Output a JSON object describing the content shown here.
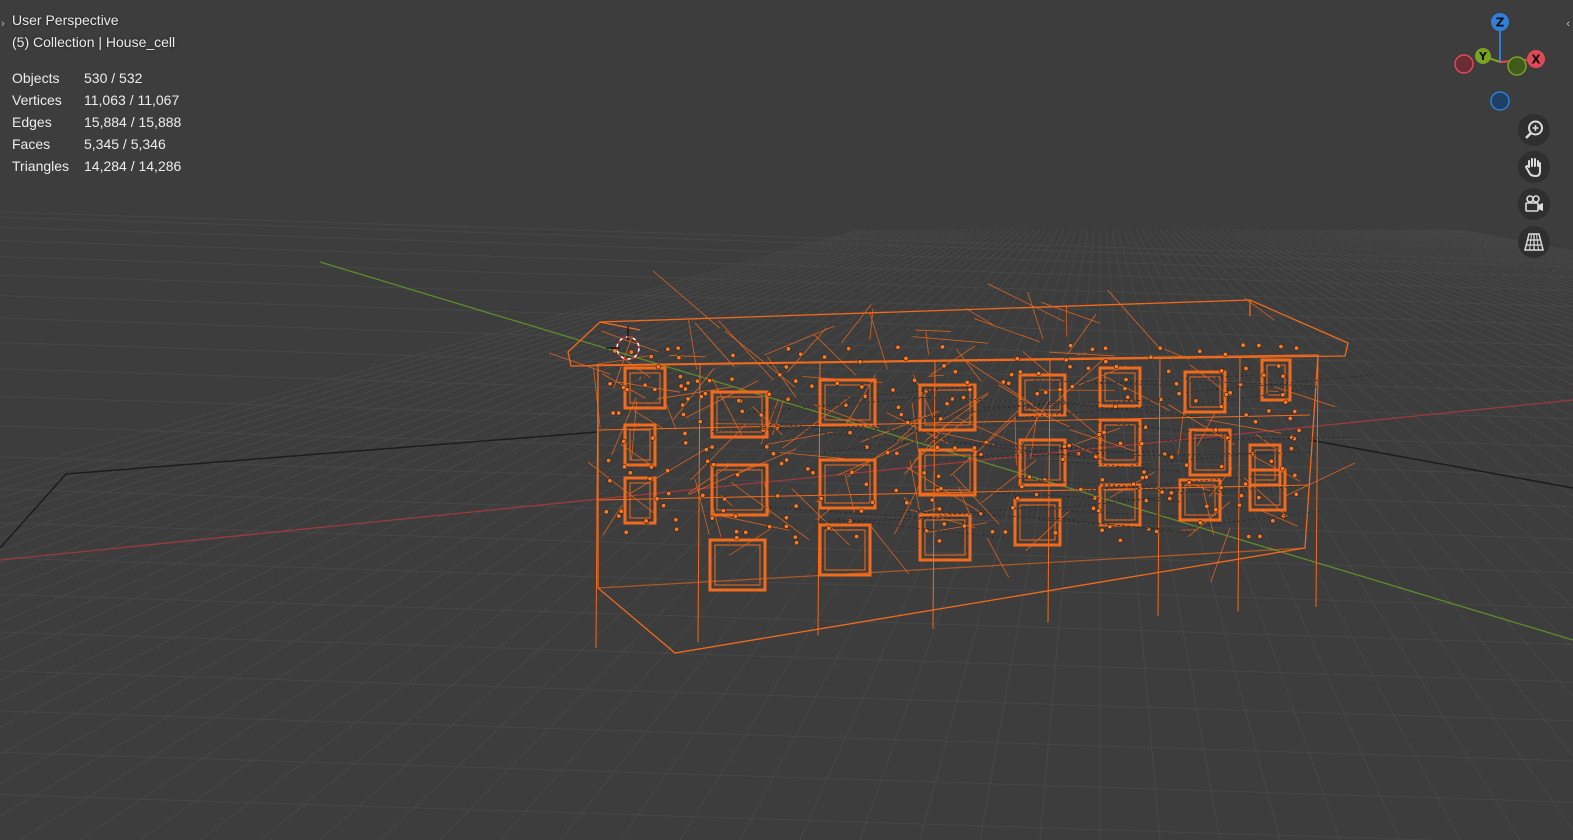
{
  "viewport": {
    "view_name": "User Perspective",
    "collection_line": "(5) Collection | House_cell",
    "stats": [
      {
        "label": "Objects",
        "value": "530 / 532"
      },
      {
        "label": "Vertices",
        "value": "11,063 / 11,067"
      },
      {
        "label": "Edges",
        "value": "15,884 / 15,888"
      },
      {
        "label": "Faces",
        "value": "5,345 / 5,346"
      },
      {
        "label": "Triangles",
        "value": "14,284 / 14,286"
      }
    ]
  },
  "gizmo": {
    "x_label": "X",
    "y_label": "Y",
    "z_label": "Z",
    "colors": {
      "x": "#e04a58",
      "y": "#7aa323",
      "z": "#2f7fd9"
    }
  },
  "nav_buttons": [
    {
      "name": "zoom",
      "icon": "zoom-in-icon"
    },
    {
      "name": "pan",
      "icon": "hand-icon"
    },
    {
      "name": "camera",
      "icon": "camera-icon"
    },
    {
      "name": "perspective",
      "icon": "grid-perspective-icon"
    }
  ],
  "colors": {
    "background": "#3d3d3d",
    "grid": "#454545",
    "selection": "#f26a1b",
    "x_axis": "#9a3b3f",
    "y_axis": "#5e8a2c"
  }
}
